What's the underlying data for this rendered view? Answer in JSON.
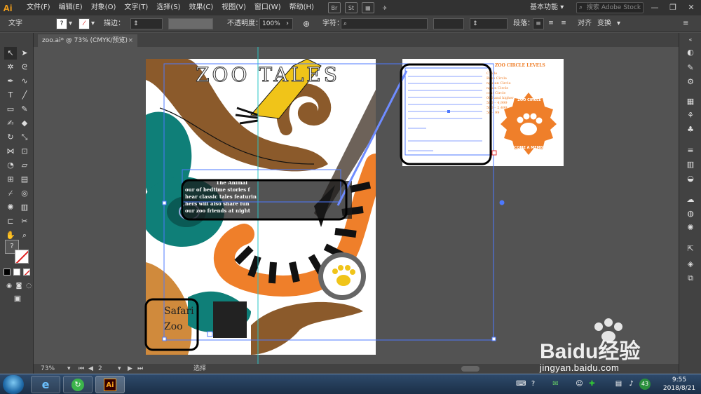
{
  "app": {
    "logo": "Ai",
    "menus": [
      "文件(F)",
      "编辑(E)",
      "对象(O)",
      "文字(T)",
      "选择(S)",
      "效果(C)",
      "视图(V)",
      "窗口(W)",
      "帮助(H)"
    ],
    "bridge_label": "Br",
    "stock_label": "St",
    "workspace": "基本功能",
    "search_placeholder": "搜索 Adobe Stock"
  },
  "control_bar": {
    "tool_label": "文字",
    "stroke_label": "描边：",
    "opacity_label": "不透明度：",
    "opacity_value": "100%",
    "char_label": "字符：",
    "paragraph_label": "段落：",
    "align_label": "对齐",
    "transform_label": "变换"
  },
  "tab": {
    "title": "zoo.ai* @ 73% (CMYK/预览)",
    "close": "×"
  },
  "artboard": {
    "headline": "ZOO TALES",
    "body_lines": [
      "The Animal",
      "our of bedtime stories f",
      "hear classic tales featurin",
      "hers will also share fun",
      "our zoo friends at night"
    ],
    "safari": "Safari",
    "zoo": "Zoo"
  },
  "circle_levels": {
    "title": "ZOO CIRCLE LEVELS",
    "items": [
      "Circle",
      "Base Circle",
      "ngutan Circle",
      "nguin Circle",
      "ccat Circle",
      "000 and higher",
      "500 – 4,999",
      "500 – 2,499",
      "50 – 99"
    ],
    "badge_top": "ZOO CIRCLE",
    "badge_bottom": "BECOME A MEMBER"
  },
  "status": {
    "zoom": "73%",
    "page": "2",
    "tool_name": "选择"
  },
  "taskbar": {
    "time": "9:55",
    "date": "2018/8/21",
    "badge": "43",
    "ai_label": "Ai"
  },
  "watermark": {
    "brand": "Baidu经验",
    "url": "jingyan.baidu.com"
  },
  "colors": {
    "brown": "#8b5a2b",
    "teal": "#0f7f78",
    "orange": "#ef7f2a",
    "gold": "#f0c419",
    "selection": "#4d79ff",
    "guide": "#29c4c4"
  }
}
